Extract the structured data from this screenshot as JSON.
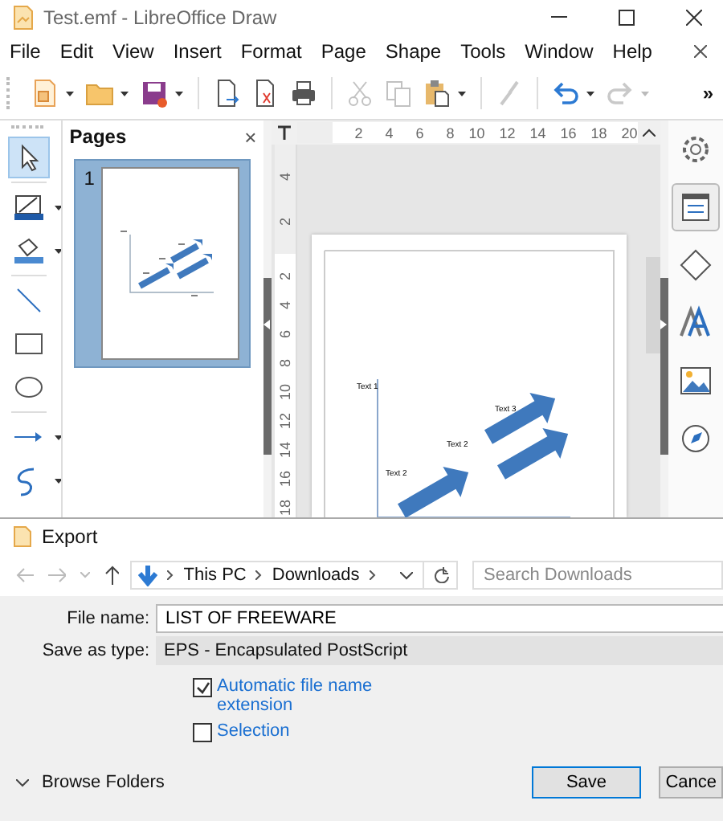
{
  "window": {
    "title": "Test.emf - LibreOffice Draw"
  },
  "menu": [
    {
      "label": "File"
    },
    {
      "label": "Edit"
    },
    {
      "label": "View"
    },
    {
      "label": "Insert"
    },
    {
      "label": "Format"
    },
    {
      "label": "Page"
    },
    {
      "label": "Shape"
    },
    {
      "label": "Tools"
    },
    {
      "label": "Window"
    },
    {
      "label": "Help"
    }
  ],
  "toolbar": {
    "groups": [
      [
        {
          "kind": "new",
          "disabled": false,
          "dropdown": true
        },
        {
          "kind": "open",
          "disabled": false,
          "dropdown": true
        },
        {
          "kind": "save",
          "disabled": false,
          "dropdown": true
        }
      ],
      [
        {
          "kind": "export",
          "disabled": false,
          "dropdown": false
        },
        {
          "kind": "pdf",
          "disabled": false,
          "dropdown": false
        },
        {
          "kind": "print",
          "disabled": false,
          "dropdown": false
        }
      ],
      [
        {
          "kind": "cut",
          "disabled": true,
          "dropdown": false
        },
        {
          "kind": "copy",
          "disabled": true,
          "dropdown": false
        },
        {
          "kind": "paste",
          "disabled": false,
          "dropdown": true
        }
      ],
      [
        {
          "kind": "clone",
          "disabled": true,
          "dropdown": false
        }
      ],
      [
        {
          "kind": "undo",
          "disabled": false,
          "dropdown": true
        },
        {
          "kind": "redo",
          "disabled": true,
          "dropdown": true
        }
      ]
    ],
    "overflow": "»"
  },
  "left_tools": [
    {
      "kind": "select",
      "selected": true,
      "dropdown": false
    },
    {
      "kind": "line-color",
      "selected": false,
      "dropdown": true
    },
    {
      "kind": "fill",
      "selected": false,
      "dropdown": true
    },
    {
      "kind": "line",
      "selected": false,
      "dropdown": false
    },
    {
      "kind": "rect",
      "selected": false,
      "dropdown": false
    },
    {
      "kind": "ellipse",
      "selected": false,
      "dropdown": false
    },
    {
      "kind": "arrow",
      "selected": false,
      "dropdown": true
    },
    {
      "kind": "curve",
      "selected": false,
      "dropdown": true
    }
  ],
  "pages_panel": {
    "title": "Pages",
    "close": "×",
    "pages": [
      {
        "number": "1",
        "selected": true
      }
    ]
  },
  "rulers": {
    "horizontal": [
      "2",
      "4",
      "6",
      "8",
      "10",
      "12",
      "14",
      "16",
      "18",
      "20"
    ],
    "vertical_above": [
      "4",
      "2"
    ],
    "vertical": [
      "2",
      "4",
      "6",
      "8",
      "10",
      "12",
      "14",
      "16",
      "18"
    ]
  },
  "drawing": {
    "labels": [
      "Text 1",
      "Text 2",
      "Text 2",
      "Text 3"
    ]
  },
  "sidebar": [
    {
      "kind": "settings",
      "selected": false
    },
    {
      "kind": "properties",
      "selected": true
    },
    {
      "kind": "shapes",
      "selected": false
    },
    {
      "kind": "styles",
      "selected": false
    },
    {
      "kind": "gallery",
      "selected": false
    },
    {
      "kind": "navigator",
      "selected": false
    }
  ],
  "dialog": {
    "title": "Export",
    "path": [
      "This PC",
      "Downloads"
    ],
    "search": {
      "placeholder": "Search Downloads"
    },
    "file_name": {
      "label": "File name:",
      "value": "LIST OF FREEWARE"
    },
    "save_type": {
      "label": "Save as type:",
      "value": "EPS - Encapsulated PostScript"
    },
    "options": [
      {
        "label": "Automatic file name extension",
        "checked": true
      },
      {
        "label": "Selection",
        "checked": false
      }
    ],
    "browse": "Browse Folders",
    "buttons": [
      {
        "label": "Save",
        "default": true
      },
      {
        "label": "Cance",
        "default": false
      }
    ]
  }
}
